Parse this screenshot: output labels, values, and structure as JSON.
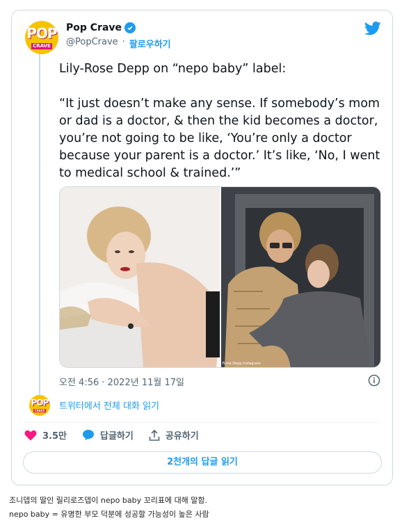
{
  "tweet": {
    "author_name": "Pop Crave",
    "avatar_logo": {
      "top": "POP",
      "bottom": "CRAVE"
    },
    "handle": "@PopCrave",
    "separator": "·",
    "follow_label": "팔로우하기",
    "text": "Lily-Rose Depp on “nepo baby” label:\n\n“It just doesn’t make any sense. If somebody’s mom or dad is a doctor, & then the kid becomes a doctor, you’re not going to be like, ‘You’re only a doctor because your parent is a doctor.’ It’s like, ‘No, I went to medical school & trained.’”",
    "photo_credit": "Fiona Depp Instagram",
    "timestamp": "오전 4:56 · 2022년 11월 17일",
    "read_conversation": "트위터에서 전체 대화 읽기",
    "likes": "3.5만",
    "reply_label": "답글하기",
    "share_label": "공유하기",
    "read_replies": "2천개의 답글 읽기"
  },
  "colors": {
    "accent": "#1d9bf0",
    "like": "#f91880",
    "avatar_bg": "#f5c400"
  },
  "caption": {
    "line1": "조니뎁의 딸인 릴리로즈뎁이 nepo baby 꼬리표에 대해 말함.",
    "line2": "nepo baby = 유명한 부모 덕분에 성공할 가능성이 높은 사람"
  }
}
